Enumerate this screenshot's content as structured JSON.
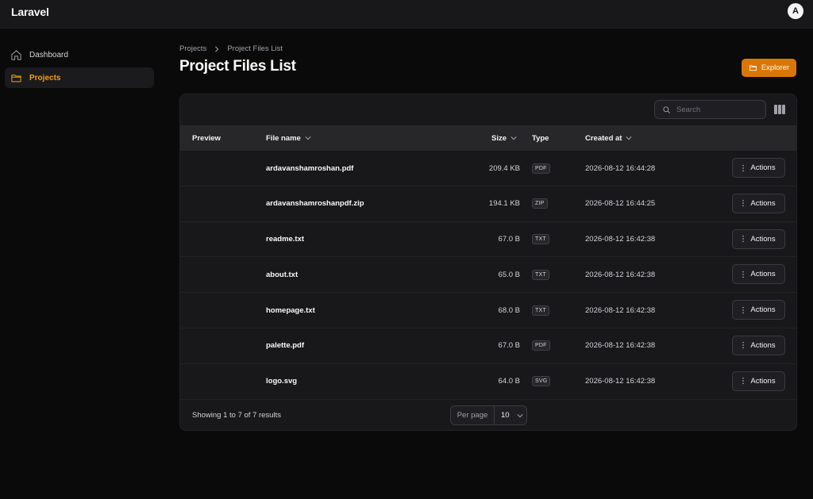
{
  "app": {
    "title": "Laravel",
    "user_initial": "A"
  },
  "sidebar": {
    "items": [
      {
        "label": "Dashboard",
        "icon": "home-icon",
        "active": false
      },
      {
        "label": "Projects",
        "icon": "folder-icon",
        "active": true
      }
    ]
  },
  "breadcrumb": {
    "items": [
      "Projects",
      "Project Files List"
    ]
  },
  "page": {
    "title": "Project Files List",
    "explorer_label": "Explorer"
  },
  "search": {
    "placeholder": "Search",
    "value": ""
  },
  "table": {
    "columns": {
      "preview": "Preview",
      "file_name": "File name",
      "size": "Size",
      "type": "Type",
      "created_at": "Created at"
    },
    "action_label": "Actions",
    "rows": [
      {
        "name": "ardavanshamroshan.pdf",
        "size": "209.4 KB",
        "type": "PDF",
        "created": "2026-08-12 16:44:28"
      },
      {
        "name": "ardavanshamroshanpdf.zip",
        "size": "194.1 KB",
        "type": "ZIP",
        "created": "2026-08-12 16:44:25"
      },
      {
        "name": "readme.txt",
        "size": "67.0 B",
        "type": "TXT",
        "created": "2026-08-12 16:42:38"
      },
      {
        "name": "about.txt",
        "size": "65.0 B",
        "type": "TXT",
        "created": "2026-08-12 16:42:38"
      },
      {
        "name": "homepage.txt",
        "size": "68.0 B",
        "type": "TXT",
        "created": "2026-08-12 16:42:38"
      },
      {
        "name": "palette.pdf",
        "size": "67.0 B",
        "type": "PDF",
        "created": "2026-08-12 16:42:38"
      },
      {
        "name": "logo.svg",
        "size": "64.0 B",
        "type": "SVG",
        "created": "2026-08-12 16:42:38"
      }
    ]
  },
  "pagination": {
    "results_text": "Showing 1 to 7 of 7 results",
    "per_page_label": "Per page",
    "per_page_value": "10"
  },
  "colors": {
    "accent": "#d97706",
    "active_nav": "#f59e0b",
    "background": "#0a0a0b",
    "panel": "#18181b"
  }
}
